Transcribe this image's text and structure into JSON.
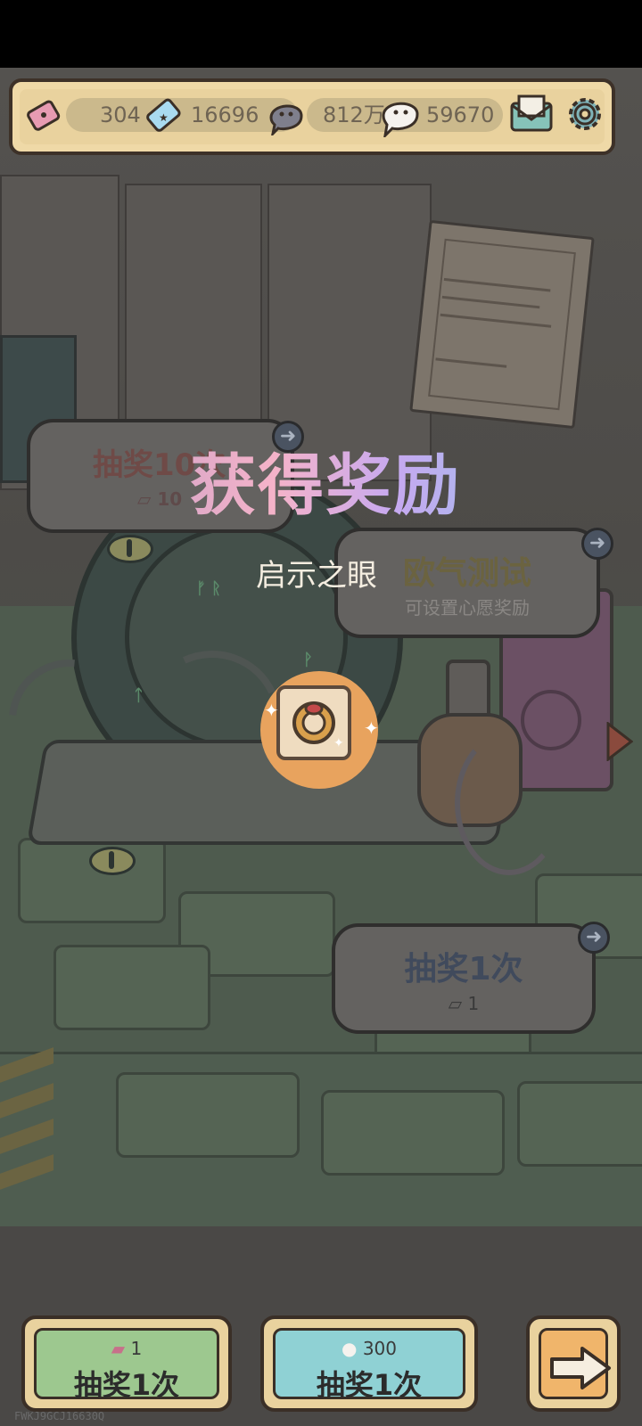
{
  "header": {
    "ticket_count": "304",
    "gem_count": "16696",
    "dark_soul_count": "812万",
    "light_soul_count": "59670"
  },
  "scene": {
    "draw10": {
      "title": "抽奖10次",
      "cost": "10"
    },
    "luck_test": {
      "title": "欧气测试",
      "subtitle": "可设置心愿奖励"
    },
    "draw1": {
      "title": "抽奖1次",
      "cost": "1"
    }
  },
  "reward": {
    "title": "获得奖励",
    "item_name": "启示之眼"
  },
  "bottom": {
    "ticket_draw": {
      "cost": "1",
      "label": "抽奖1次"
    },
    "soul_draw": {
      "cost": "300",
      "label": "抽奖1次"
    }
  },
  "watermark": "FWKJ9GCJ16630Q",
  "colors": {
    "topbar_bg": "#efd9a7",
    "green_button": "#9dc88f",
    "blue_button": "#8fd1d4",
    "orange_button": "#f0b56b",
    "reward_circle": "#e8a35e"
  }
}
